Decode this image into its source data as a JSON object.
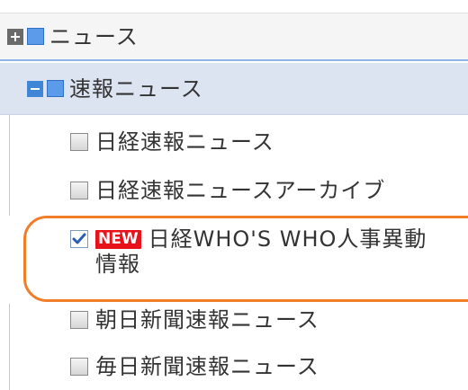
{
  "tree": {
    "root": {
      "label": "ニュース",
      "expand_icon": "plus-icon",
      "folder_icon": "blue-square-icon"
    },
    "section": {
      "label": "速報ニュース",
      "collapse_icon": "minus-icon",
      "folder_icon": "blue-square-icon"
    },
    "items": [
      {
        "label": "日経速報ニュース",
        "checked": false
      },
      {
        "label": "日経速報ニュースアーカイブ",
        "checked": false
      },
      {
        "badge": "NEW",
        "label_line1": "日経WHO'S WHO人事異動",
        "label_line2": "情報",
        "checked": true
      },
      {
        "label": "朝日新聞速報ニュース",
        "checked": false
      },
      {
        "label": "毎日新聞速報ニュース",
        "checked": false
      }
    ]
  },
  "colors": {
    "highlight": "#f07d28",
    "badge": "#e8121a",
    "section_bg": "#dde4f1",
    "accent_blue": "#5b9bea"
  }
}
